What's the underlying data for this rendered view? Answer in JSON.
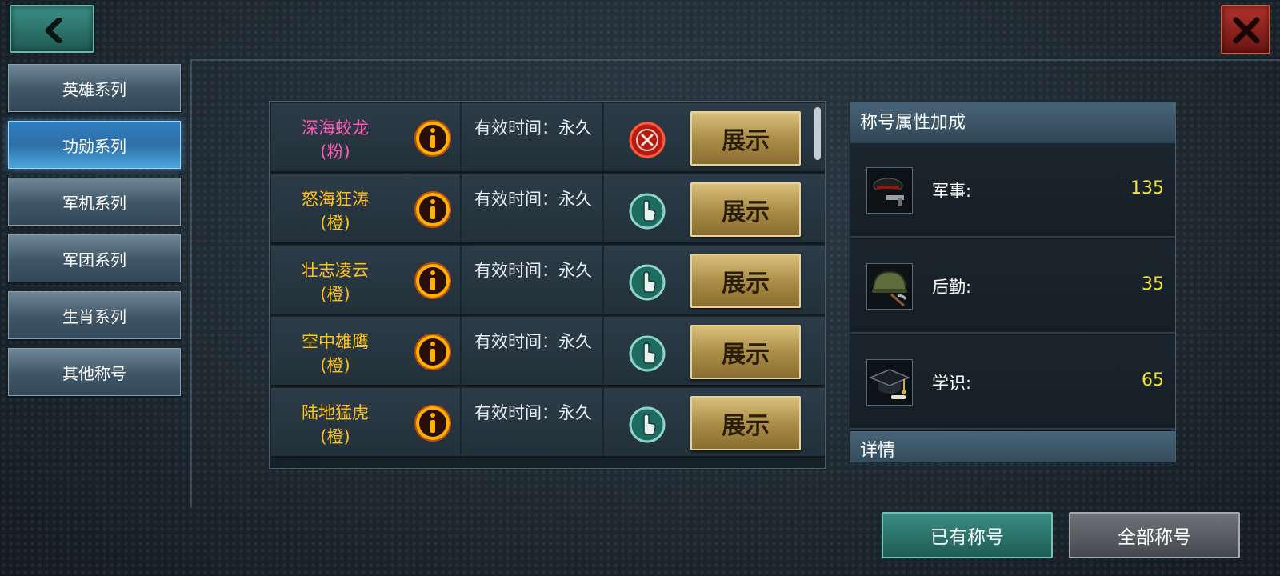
{
  "header": {
    "back_icon": "chevron-left-icon",
    "close_icon": "close-x-icon"
  },
  "sidebar": {
    "items": [
      {
        "label": "英雄系列",
        "active": false
      },
      {
        "label": "功勋系列",
        "active": true
      },
      {
        "label": "军机系列",
        "active": false
      },
      {
        "label": "军团系列",
        "active": false
      },
      {
        "label": "生肖系列",
        "active": false
      },
      {
        "label": "其他称号",
        "active": false
      }
    ]
  },
  "titles": {
    "rows": [
      {
        "name": "深海蛟龙",
        "grade": "(粉)",
        "color": "#ff5ab4",
        "duration": "有效时间：永久",
        "state": "cancel-icon",
        "button": "展示"
      },
      {
        "name": "怒海狂涛",
        "grade": "(橙)",
        "color": "#ffc21a",
        "duration": "有效时间：永久",
        "state": "hand-pointer-icon",
        "button": "展示"
      },
      {
        "name": "壮志凌云",
        "grade": "(橙)",
        "color": "#ffc21a",
        "duration": "有效时间：永久",
        "state": "hand-pointer-icon",
        "button": "展示"
      },
      {
        "name": "空中雄鹰",
        "grade": "(橙)",
        "color": "#ffc21a",
        "duration": "有效时间：永久",
        "state": "hand-pointer-icon",
        "button": "展示"
      },
      {
        "name": "陆地猛虎",
        "grade": "(橙)",
        "color": "#ffc21a",
        "duration": "有效时间：永久",
        "state": "hand-pointer-icon",
        "button": "展示"
      }
    ]
  },
  "attributes": {
    "header": "称号属性加成",
    "items": [
      {
        "label": "军事:",
        "value": "135",
        "icon": "officer-cap-pistol-icon"
      },
      {
        "label": "后勤:",
        "value": "35",
        "icon": "helmet-pickaxe-icon"
      },
      {
        "label": "学识:",
        "value": "65",
        "icon": "graduation-cap-icon"
      }
    ],
    "detail_header": "详情"
  },
  "footer": {
    "owned_label": "已有称号",
    "all_label": "全部称号"
  }
}
